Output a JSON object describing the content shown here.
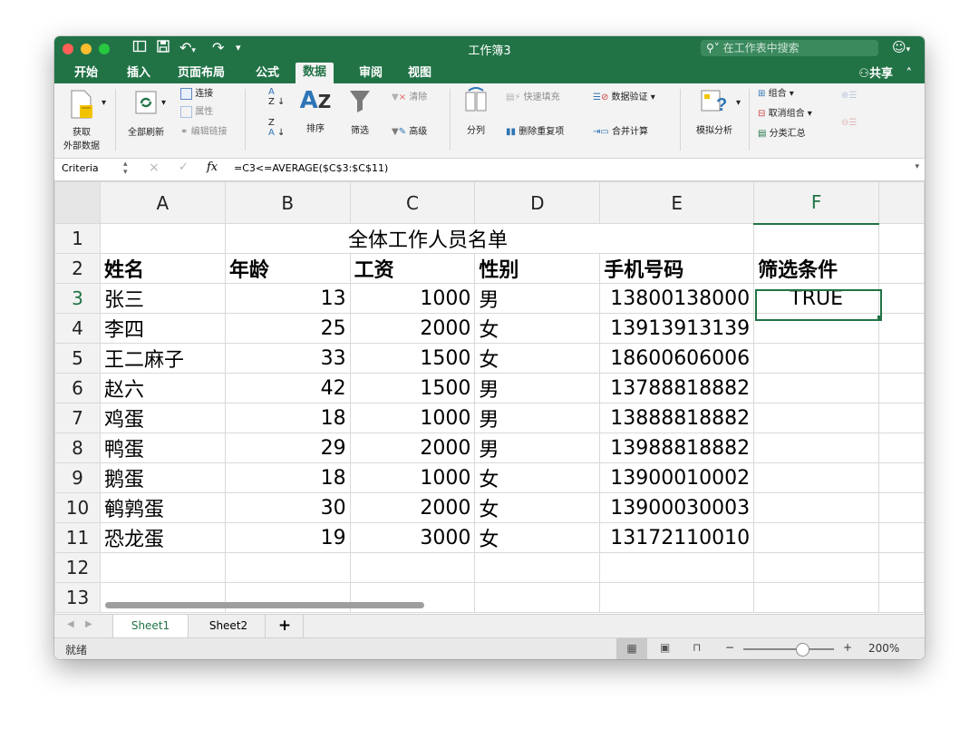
{
  "window": {
    "title": "工作簿3",
    "search_placeholder": "在工作表中搜索",
    "share_label": "共享"
  },
  "ribbon_tabs": [
    "开始",
    "插入",
    "页面布局",
    "公式",
    "数据",
    "审阅",
    "视图"
  ],
  "active_tab": "数据",
  "ribbon": {
    "get_external_data_line1": "获取",
    "get_external_data_line2": "外部数据",
    "refresh_all": "全部刷新",
    "connections": "连接",
    "properties": "属性",
    "edit_links": "编辑链接",
    "sort": "排序",
    "filter": "筛选",
    "clear": "清除",
    "advanced": "高级",
    "text_to_columns": "分列",
    "flash_fill": "快速填充",
    "remove_duplicates": "删除重复项",
    "data_validation": "数据验证",
    "consolidate": "合并计算",
    "what_if": "模拟分析",
    "group": "组合",
    "ungroup": "取消组合",
    "subtotal": "分类汇总"
  },
  "formula_bar": {
    "name_box": "Criteria",
    "fx": "fx",
    "formula": "=C3<=AVERAGE($C$3:$C$11)"
  },
  "columns": [
    "A",
    "B",
    "C",
    "D",
    "E",
    "F"
  ],
  "rows": [
    {
      "num": "1",
      "cells": [
        "",
        "全体工作人员名单",
        "",
        "",
        "",
        ""
      ]
    },
    {
      "num": "2",
      "cells": [
        "姓名",
        "年龄",
        "工资",
        "性别",
        "手机号码",
        "筛选条件"
      ]
    },
    {
      "num": "3",
      "cells": [
        "张三",
        "13",
        "1000",
        "男",
        "13800138000",
        "TRUE"
      ]
    },
    {
      "num": "4",
      "cells": [
        "李四",
        "25",
        "2000",
        "女",
        "13913913139",
        ""
      ]
    },
    {
      "num": "5",
      "cells": [
        "王二麻子",
        "33",
        "1500",
        "女",
        "18600606006",
        ""
      ]
    },
    {
      "num": "6",
      "cells": [
        "赵六",
        "42",
        "1500",
        "男",
        "13788818882",
        ""
      ]
    },
    {
      "num": "7",
      "cells": [
        "鸡蛋",
        "18",
        "1000",
        "男",
        "13888818882",
        ""
      ]
    },
    {
      "num": "8",
      "cells": [
        "鸭蛋",
        "29",
        "2000",
        "男",
        "13988818882",
        ""
      ]
    },
    {
      "num": "9",
      "cells": [
        "鹅蛋",
        "18",
        "1000",
        "女",
        "13900010002",
        ""
      ]
    },
    {
      "num": "10",
      "cells": [
        "鹌鹑蛋",
        "30",
        "2000",
        "女",
        "13900030003",
        ""
      ]
    },
    {
      "num": "11",
      "cells": [
        "恐龙蛋",
        "19",
        "3000",
        "女",
        "13172110010",
        ""
      ]
    },
    {
      "num": "12",
      "cells": [
        "",
        "",
        "",
        "",
        "",
        ""
      ]
    },
    {
      "num": "13",
      "cells": [
        "",
        "",
        "",
        "",
        "",
        ""
      ]
    }
  ],
  "sheets": [
    "Sheet1",
    "Sheet2"
  ],
  "add_sheet": "+",
  "status": {
    "ready": "就绪",
    "zoom": "200%",
    "zoom_minus": "−",
    "zoom_plus": "+"
  },
  "colors": {
    "excel_green": "#217346",
    "criteria_blue": "#2e75b6"
  }
}
